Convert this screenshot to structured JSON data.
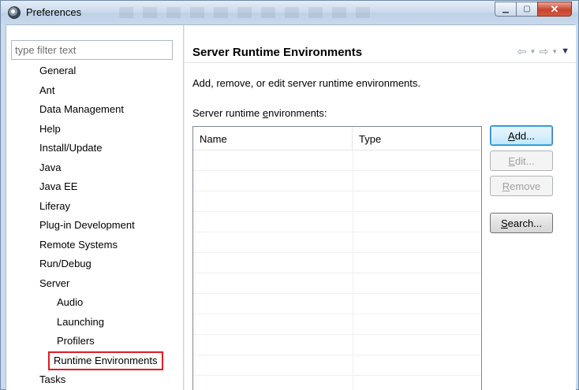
{
  "window": {
    "title": "Preferences",
    "icon": "eclipse-gear-icon",
    "controls": {
      "minimize": "minimize-icon",
      "maximize": "maximize-icon",
      "close": "close-icon"
    }
  },
  "filter": {
    "placeholder": "type filter text",
    "value": ""
  },
  "tree": {
    "items": [
      {
        "label": "General",
        "level": 0
      },
      {
        "label": "Ant",
        "level": 0
      },
      {
        "label": "Data Management",
        "level": 0
      },
      {
        "label": "Help",
        "level": 0
      },
      {
        "label": "Install/Update",
        "level": 0
      },
      {
        "label": "Java",
        "level": 0
      },
      {
        "label": "Java EE",
        "level": 0
      },
      {
        "label": "Liferay",
        "level": 0
      },
      {
        "label": "Plug-in Development",
        "level": 0
      },
      {
        "label": "Remote Systems",
        "level": 0
      },
      {
        "label": "Run/Debug",
        "level": 0
      },
      {
        "label": "Server",
        "level": 0
      },
      {
        "label": "Audio",
        "level": 1
      },
      {
        "label": "Launching",
        "level": 1
      },
      {
        "label": "Profilers",
        "level": 1
      },
      {
        "label": "Runtime Environments",
        "level": 1,
        "selected": true
      },
      {
        "label": "Tasks",
        "level": 0
      }
    ]
  },
  "page": {
    "title": "Server Runtime Environments",
    "description": "Add, remove, or edit server runtime environments.",
    "list_label_pre": "Server runtime ",
    "list_label_mnemonic": "e",
    "list_label_post": "nvironments:",
    "nav": {
      "back": "back-arrow-icon",
      "forward": "forward-arrow-icon",
      "menu": "view-menu-icon"
    }
  },
  "table": {
    "columns": [
      "Name",
      "Type"
    ],
    "rows": []
  },
  "buttons": {
    "add": {
      "mnemonic": "A",
      "rest": "dd...",
      "enabled": true
    },
    "edit": {
      "mnemonic": "E",
      "rest": "dit...",
      "enabled": false
    },
    "remove": {
      "mnemonic": "R",
      "rest": "emove",
      "enabled": false
    },
    "search": {
      "mnemonic": "S",
      "rest": "earch...",
      "enabled": true
    }
  },
  "colors": {
    "selection_highlight": "#e01c24",
    "titlebar": "#cbdcee"
  }
}
